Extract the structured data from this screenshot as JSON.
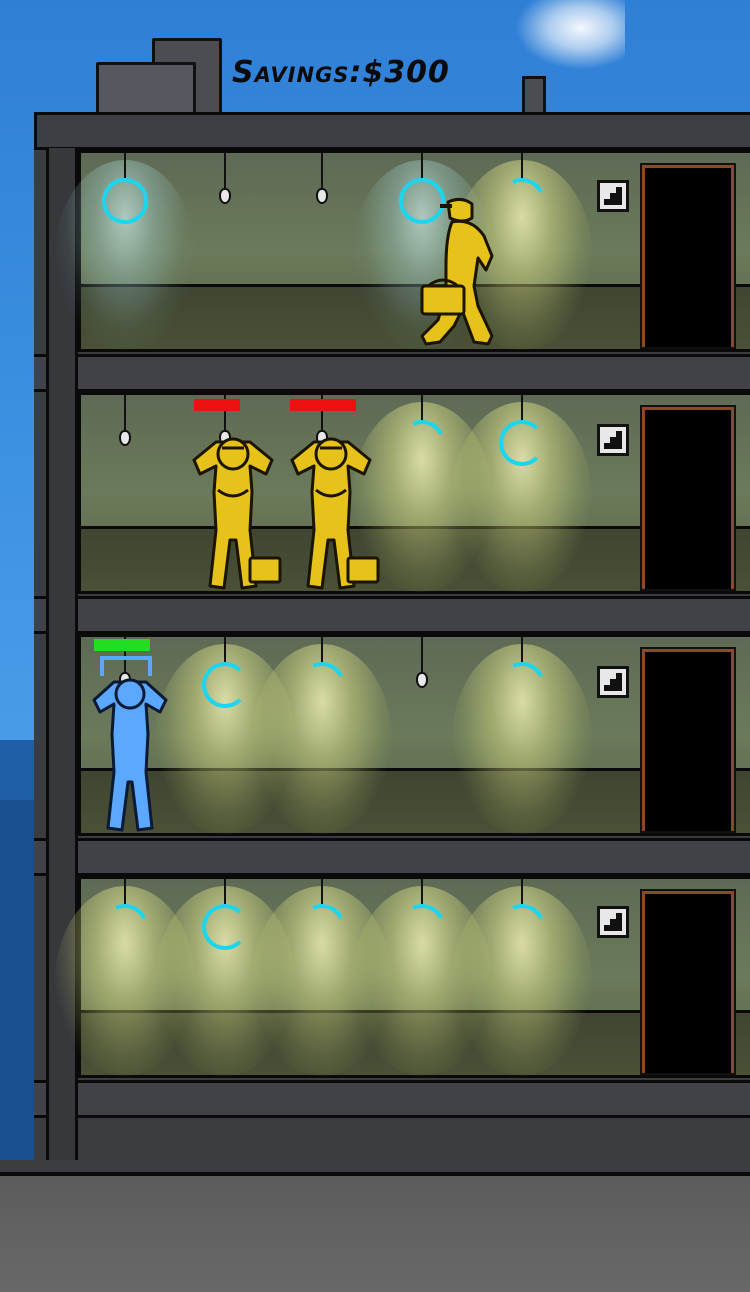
{
  "hud": {
    "savings_label": "Savings:",
    "savings_value": "$300"
  },
  "colors": {
    "ring": "#1cd6f0",
    "villain": "#e6c21a",
    "player": "#5aa8ff",
    "health_good": "#22dd22",
    "health_bad": "#ee1111",
    "door_frame": "#8a4a2a"
  },
  "floors": [
    {
      "lights": [
        {
          "state": "ring-full"
        },
        {
          "state": "bulb"
        },
        {
          "state": "bulb"
        },
        {
          "state": "ring-full"
        },
        {
          "state": "ring-partial"
        }
      ]
    },
    {
      "lights": [
        {
          "state": "bulb"
        },
        {
          "state": "bulb"
        },
        {
          "state": "bulb"
        },
        {
          "state": "ring-partial"
        },
        {
          "state": "ring-full"
        }
      ]
    },
    {
      "lights": [
        {
          "state": "bulb"
        },
        {
          "state": "ring-full"
        },
        {
          "state": "ring-partial"
        },
        {
          "state": "bulb"
        },
        {
          "state": "ring-partial"
        }
      ]
    },
    {
      "lights": [
        {
          "state": "ring-partial"
        },
        {
          "state": "ring-full"
        },
        {
          "state": "ring-partial"
        },
        {
          "state": "ring-partial"
        },
        {
          "state": "ring-partial"
        }
      ]
    }
  ],
  "characters": [
    {
      "role": "villain-walking",
      "floor": 1,
      "carrying": "toolbox"
    },
    {
      "role": "villain-hostage",
      "floor": 2,
      "health": 0.4
    },
    {
      "role": "villain-hostage",
      "floor": 2,
      "health": 0.85
    },
    {
      "role": "player-hostage",
      "floor": 3,
      "health": 1.0,
      "selected": true
    }
  ]
}
